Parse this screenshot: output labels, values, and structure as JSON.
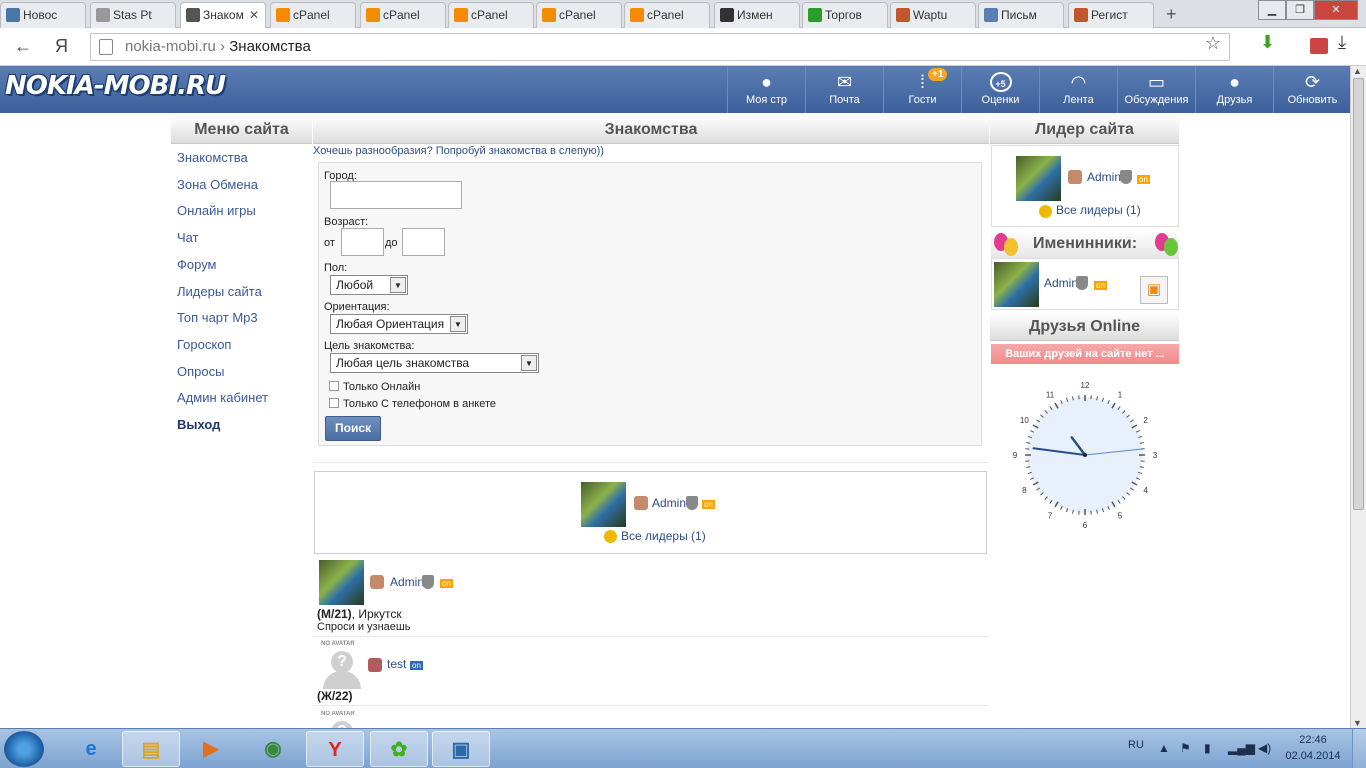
{
  "browser": {
    "tabs": [
      {
        "label": "Новос",
        "icon": "vk-icon",
        "color": "#4a76a8"
      },
      {
        "label": "Stas Pt",
        "icon": "page-icon",
        "color": "#999999"
      },
      {
        "label": "Знаком",
        "icon": "user-icon",
        "color": "#555555",
        "active": true
      },
      {
        "label": "cPanel",
        "icon": "cpanel-icon",
        "color": "#f28c00"
      },
      {
        "label": "cPanel",
        "icon": "cpanel-icon",
        "color": "#f28c00"
      },
      {
        "label": "cPanel",
        "icon": "cpanel-icon",
        "color": "#f28c00"
      },
      {
        "label": "cPanel",
        "icon": "cpanel-icon",
        "color": "#f28c00"
      },
      {
        "label": "cPanel",
        "icon": "cpanel-icon",
        "color": "#f28c00"
      },
      {
        "label": "Измен",
        "icon": "edit-icon",
        "color": "#333333"
      },
      {
        "label": "Торгов",
        "icon": "check-icon",
        "color": "#2a9d2a"
      },
      {
        "label": "Waptu",
        "icon": "people-icon",
        "color": "#c2562e"
      },
      {
        "label": "Письм",
        "icon": "mail-icon",
        "color": "#5a7fb3"
      },
      {
        "label": "Регист",
        "icon": "people-icon",
        "color": "#c2562e"
      }
    ],
    "url_domain": "nokia-mobi.ru",
    "url_path": "Знакомства",
    "ya_label": "Я"
  },
  "site": {
    "logo": "NOKIA-MOBI.RU",
    "nav": [
      {
        "label": "Моя стр",
        "icon": "person-icon",
        "glyph": "●"
      },
      {
        "label": "Почта",
        "icon": "mail-icon",
        "glyph": "✉"
      },
      {
        "label": "Гости",
        "icon": "footsteps-icon",
        "glyph": "⁞",
        "badge": "+1"
      },
      {
        "label": "Оценки",
        "icon": "rating-icon",
        "glyph": "⊕",
        "badge_inline": "+5"
      },
      {
        "label": "Лента",
        "icon": "rss-icon",
        "glyph": "◠"
      },
      {
        "label": "Обсуждения",
        "icon": "chat-icon",
        "glyph": "▭"
      },
      {
        "label": "Друзья",
        "icon": "friends-icon",
        "glyph": "●"
      },
      {
        "label": "Обновить",
        "icon": "refresh-icon",
        "glyph": "⟳"
      }
    ]
  },
  "menu": {
    "title": "Меню сайта",
    "items": [
      "Знакомства",
      "Зона Обмена",
      "Онлайн игры",
      "Чат",
      "Форум",
      "Лидеры сайта",
      "Топ чарт Mp3",
      "Гороскоп",
      "Опросы",
      "Админ кабинет",
      "Выход"
    ]
  },
  "center": {
    "title": "Знакомства",
    "tip": "Хочешь разнообразия? Попробуй знакомства в слепую))",
    "form": {
      "city_label": "Город:",
      "age_label": "Возраст:",
      "from_label": "от",
      "to_label": "до",
      "sex_label": "Пол:",
      "sex_value": "Любой",
      "orient_label": "Ориентация:",
      "orient_value": "Любая Ориентация",
      "goal_label": "Цель знакомства:",
      "goal_value": "Любая цель знакомства",
      "online_only": "Только Онлайн",
      "phone_only": "Только С телефоном в анкете",
      "search_button": "Поиск"
    },
    "leader": {
      "name": "Admin",
      "on": "on",
      "all_leaders": "Все лидеры (1)"
    },
    "results": [
      {
        "name": "Admin",
        "on": "on",
        "info": "(М/21)",
        "city": ", Иркутск",
        "status": "Спроси и узнаешь"
      },
      {
        "name": "test",
        "on": "on",
        "info": "(Ж/22)",
        "noavatar": "NO AVATAR"
      },
      {
        "noavatar": "NO AVATAR"
      }
    ]
  },
  "right": {
    "leader_title": "Лидер сайта",
    "leader_name": "Admin",
    "leader_on": "on",
    "all_leaders": "Все лидеры (1)",
    "birthday_title": "Именинники:",
    "birthday_name": "Admin",
    "birthday_on": "on",
    "friends_title": "Друзья Online",
    "friends_empty": "Ваших друзей на сайте нет ...",
    "clock": {
      "hour": 10,
      "minute": 46,
      "second": 14,
      "numbers": [
        "12",
        "1",
        "2",
        "3",
        "4",
        "5",
        "6",
        "7",
        "8",
        "9",
        "10",
        "11"
      ]
    }
  },
  "taskbar": {
    "apps": [
      {
        "name": "ie-icon",
        "glyph": "e",
        "color": "#1d78d1"
      },
      {
        "name": "explorer-icon",
        "glyph": "▤",
        "color": "#d9a431",
        "open": true
      },
      {
        "name": "media-player-icon",
        "glyph": "▶",
        "color": "#e07020"
      },
      {
        "name": "chrome-icon",
        "glyph": "◉",
        "color": "#3a8a3a"
      },
      {
        "name": "yandex-browser-icon",
        "glyph": "Y",
        "color": "#e52620",
        "open": true
      },
      {
        "name": "icq-icon",
        "glyph": "✿",
        "color": "#3fae1f",
        "open": true
      },
      {
        "name": "photo-viewer-icon",
        "glyph": "▣",
        "color": "#2b6aa8",
        "open": true
      }
    ],
    "lang": "RU",
    "time": "22:46",
    "date": "02.04.2014"
  }
}
